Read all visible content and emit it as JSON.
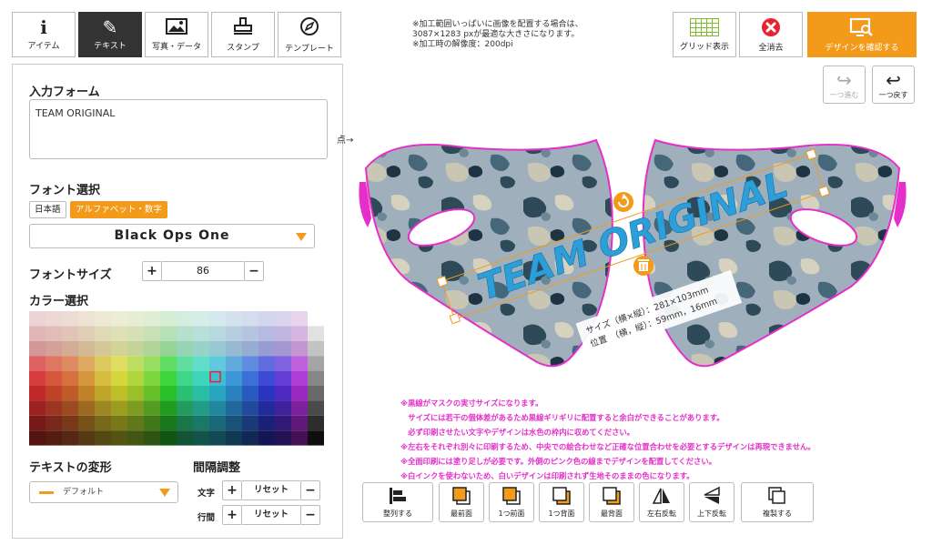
{
  "tabs": [
    {
      "label": "アイテム",
      "icon": "info-icon"
    },
    {
      "label": "テキスト",
      "icon": "pen-icon"
    },
    {
      "label": "写真・データ",
      "icon": "image-icon"
    },
    {
      "label": "スタンプ",
      "icon": "stamp-icon"
    },
    {
      "label": "テンプレート",
      "icon": "compass-icon"
    }
  ],
  "panel": {
    "input_title": "入力フォーム",
    "input_value": "TEAM ORIGINAL",
    "font_title": "フォント選択",
    "lang_ja": "日本語",
    "lang_alpha": "アルファベット・数字",
    "font_value": "Black Ops One",
    "size_title": "フォントサイズ",
    "size_value": "86",
    "plus": "+",
    "minus": "−",
    "color_title": "カラー選択",
    "transform_title": "テキストの変形",
    "transform_value": "デフォルト",
    "spacing_title": "間隔調整",
    "char_label": "文字",
    "line_label": "行間",
    "reset": "リセット"
  },
  "notice": [
    "※加工範囲いっぱいに画像を配置する場合は、",
    "3087×1283 pxが最適な大きさになります。",
    "※加工時の解像度：200dpi"
  ],
  "toolbar": {
    "grid": "グリッド表示",
    "clear": "全消去",
    "confirm": "デザインを確認する",
    "redo": "一つ進む",
    "undo": "一つ戻す"
  },
  "canvas": {
    "arrow_text": "点→",
    "design_text": "TEAM ORIGINAL",
    "size_label": "サイズ（横×縦）：281×103mm",
    "pos_label": "位置　（横，縦）：59mm，16mm"
  },
  "notes": [
    "※黒線がマスクの実寸サイズになります。",
    "　サイズには若干の個体差があるため黒線ギリギリに配置すると余白ができることがあります。",
    "　必ず印刷させたい文字やデザインは水色の枠内に収めてください。",
    "※左右をそれぞれ別々に印刷するため、中央での絵合わせなど正確な位置合わせを必要とするデザインは再現できません。",
    "※全面印刷には塗り足しが必要です。外側のピンク色の線までデザインを配置してください。",
    "※白インクを使わないため、白いデザインは印刷されず生地そのままの色になります。"
  ],
  "bottom": {
    "align": "整列する",
    "front": "最前面",
    "forward": "1つ前面",
    "backward": "1つ背面",
    "back": "最背面",
    "fliph": "左右反転",
    "flipv": "上下反転",
    "dup": "複製する"
  },
  "colors": {
    "accent": "#f39a1a",
    "pink": "#e62ec9",
    "danger": "#e8232d",
    "design_text": "#2c9ed8"
  }
}
